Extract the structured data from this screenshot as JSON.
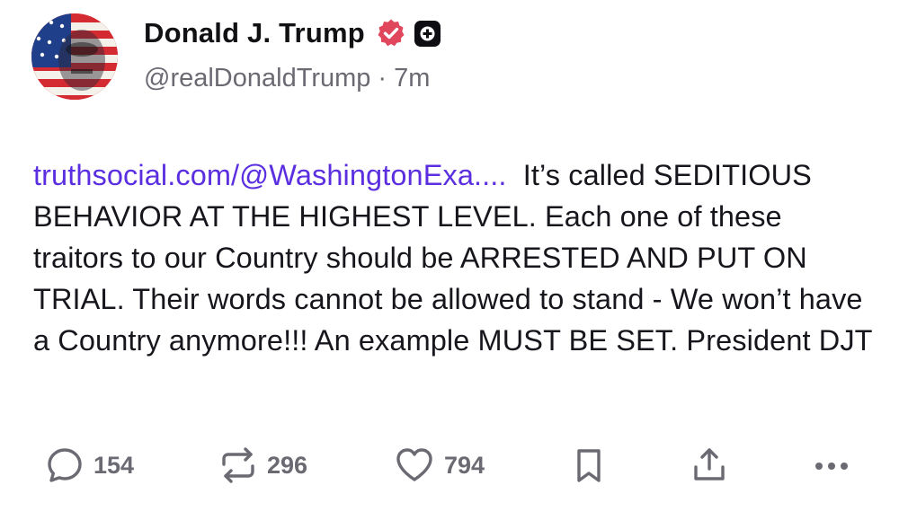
{
  "author": {
    "display_name": "Donald J. Trump",
    "handle": "@realDonaldTrump",
    "time_ago": "7m",
    "separator": "·"
  },
  "post": {
    "link_text": "truthsocial.com/@WashingtonExa....",
    "body": "It’s called SEDITIOUS BEHAVIOR AT THE HIGHEST LEVEL. Each one of these traitors to our Country should be ARRESTED AND PUT ON TRIAL. Their words cannot be allowed to stand - We won’t have a Country anymore!!! An example MUST BE SET. President DJT"
  },
  "actions": {
    "replies": "154",
    "retruths": "296",
    "likes": "794"
  },
  "colors": {
    "link": "#5b2fe0",
    "verified_badge": "#e0465c",
    "muted": "#6b6a73",
    "text": "#17161c"
  },
  "icons": {
    "verified": "verified-badge-icon",
    "plus": "plus-badge-icon",
    "reply": "reply-bubble-icon",
    "retruth": "retruth-arrows-icon",
    "like": "heart-icon",
    "bookmark": "bookmark-icon",
    "share": "share-upload-icon",
    "more": "more-dots-icon"
  }
}
